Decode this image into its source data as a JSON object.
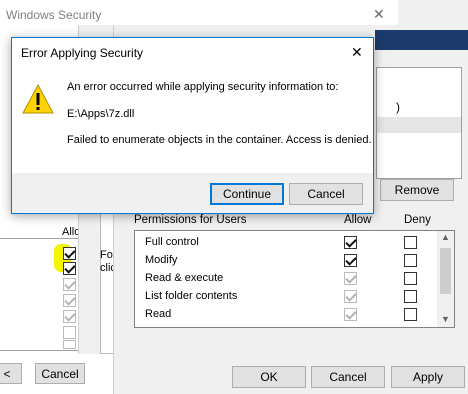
{
  "back_window": {
    "title": "Windows Security",
    "close_glyph": "✕",
    "allow_header": "Allo",
    "left_cancel_label": "Cancel",
    "left_partial_label": "<"
  },
  "middle_window": {
    "fo_text": "Fo",
    "clic_text": "clic"
  },
  "permissions_window": {
    "remove_label": "Remove",
    "header_label": "Permissions for Users",
    "allow_header": "Allow",
    "deny_header": "Deny",
    "rows": [
      {
        "label": "Full control",
        "allow": "checked",
        "deny": "empty"
      },
      {
        "label": "Modify",
        "allow": "checked",
        "deny": "empty"
      },
      {
        "label": "Read & execute",
        "allow": "checked-disabled",
        "deny": "empty"
      },
      {
        "label": "List folder contents",
        "allow": "checked-disabled",
        "deny": "empty"
      },
      {
        "label": "Read",
        "allow": "checked-disabled",
        "deny": "empty"
      }
    ],
    "ok_label": "OK",
    "cancel_label": "Cancel",
    "apply_label": "Apply",
    "partial_paren": ")"
  },
  "error_dialog": {
    "title": "Error Applying Security",
    "close_glyph": "✕",
    "message_line1": "An error occurred while applying security information to:",
    "path": "E:\\Apps\\7z.dll",
    "message_line2": "Failed to enumerate objects in the container. Access is denied.",
    "continue_label": "Continue",
    "cancel_label": "Cancel",
    "warning_glyph": "!"
  },
  "colors": {
    "highlight": "#f5f500",
    "accent_border": "#0078d7",
    "dark_blue_bar": "#1c3a6b",
    "warning_yellow": "#ffd200"
  }
}
